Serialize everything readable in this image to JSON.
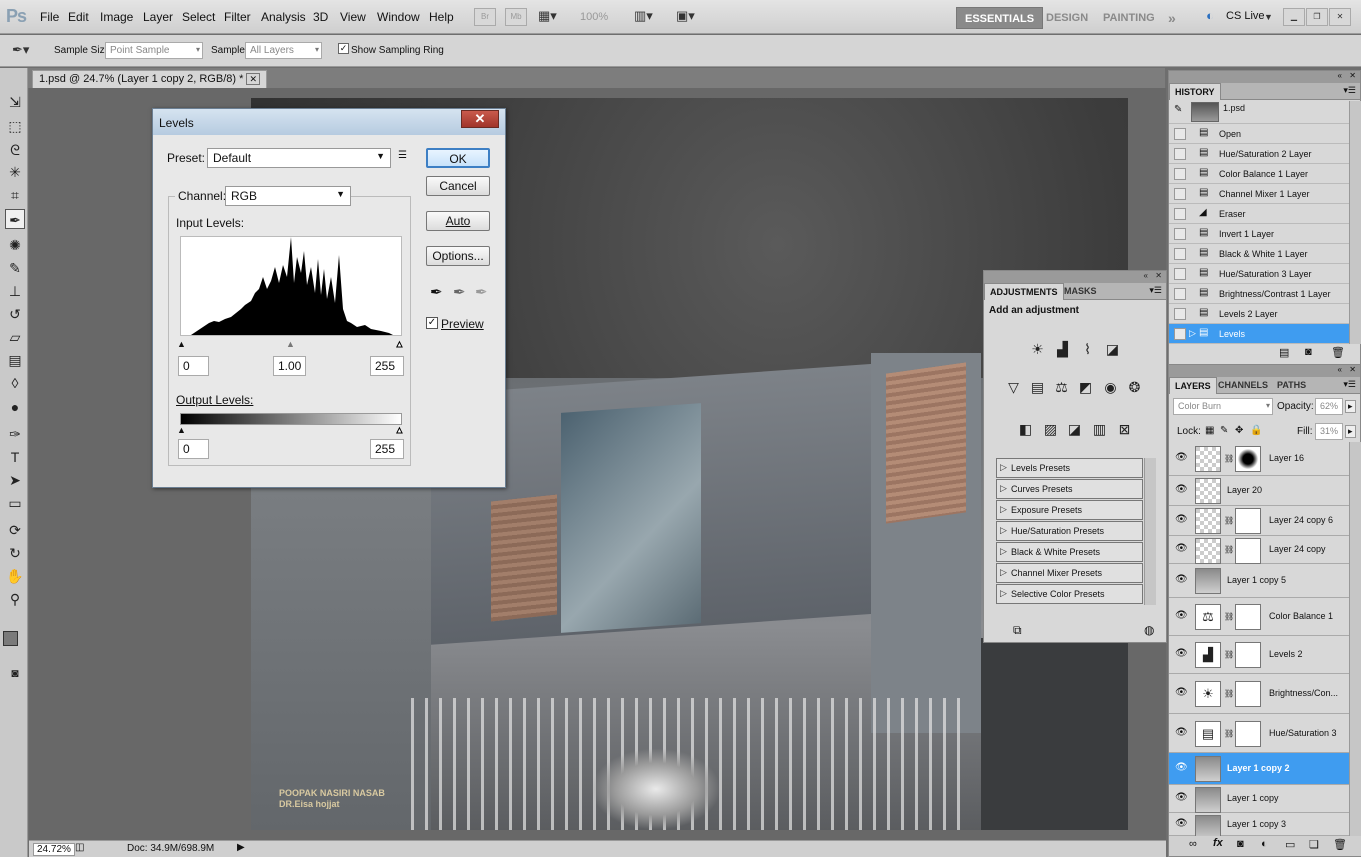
{
  "app": {
    "logo": "Ps"
  },
  "menu": [
    "File",
    "Edit",
    "Image",
    "Layer",
    "Select",
    "Filter",
    "Analysis",
    "3D",
    "View",
    "Window",
    "Help"
  ],
  "toolbar_top": {
    "zoom": "100%",
    "br": "Br",
    "mb": "Mb"
  },
  "workspaces": {
    "essentials": "ESSENTIALS",
    "design": "DESIGN",
    "painting": "PAINTING",
    "more": "»",
    "cslive": "CS Live"
  },
  "options": {
    "sample_size_label": "Sample Size:",
    "sample_size_value": "Point Sample",
    "sample_label": "Sample:",
    "sample_value": "All Layers",
    "sampling_ring": "Show Sampling Ring"
  },
  "document": {
    "tab": "1.psd @ 24.7% (Layer 1 copy 2, RGB/8) *",
    "zoom": "24.72%",
    "doc_size": "Doc: 34.9M/698.9M"
  },
  "image_credit": {
    "line1": "POOPAK NASIRI NASAB",
    "line2": "DR.Eisa hojjat"
  },
  "levels": {
    "title": "Levels",
    "preset_label": "Preset:",
    "preset_value": "Default",
    "channel_label": "Channel:",
    "channel_value": "RGB",
    "input_label": "Input Levels:",
    "input_values": [
      "0",
      "1.00",
      "255"
    ],
    "output_label": "Output Levels:",
    "output_values": [
      "0",
      "255"
    ],
    "buttons": {
      "ok": "OK",
      "cancel": "Cancel",
      "auto": "Auto",
      "options": "Options..."
    },
    "preview": "Preview"
  },
  "adjustments": {
    "tabs": [
      "ADJUSTMENTS",
      "MASKS"
    ],
    "heading": "Add an adjustment",
    "presets": [
      "Levels Presets",
      "Curves Presets",
      "Exposure Presets",
      "Hue/Saturation Presets",
      "Black & White Presets",
      "Channel Mixer Presets",
      "Selective Color Presets"
    ]
  },
  "history": {
    "title": "HISTORY",
    "snapshot": "1.psd",
    "items": [
      "Open",
      "Hue/Saturation 2 Layer",
      "Color Balance 1 Layer",
      "Channel Mixer 1 Layer",
      "Eraser",
      "Invert 1 Layer",
      "Black & White 1 Layer",
      "Hue/Saturation 3 Layer",
      "Brightness/Contrast 1 Layer",
      "Levels 2 Layer",
      "Levels"
    ],
    "active_index": 10
  },
  "layers": {
    "tabs": [
      "LAYERS",
      "CHANNELS",
      "PATHS"
    ],
    "blend_mode": "Color Burn",
    "opacity_label": "Opacity:",
    "opacity": "62%",
    "lock_label": "Lock:",
    "fill_label": "Fill:",
    "fill": "31%",
    "items": [
      "Layer 16",
      "Layer 20",
      "Layer 24 copy 6",
      "Layer 24 copy",
      "Layer 1 copy 5",
      "Color Balance 1",
      "Levels 2",
      "Brightness/Con...",
      "Hue/Saturation 3",
      "Layer 1 copy 2",
      "Layer 1 copy",
      "Layer 1 copy 3"
    ],
    "active_index": 9
  },
  "colors": {
    "accent": "#3f9cf0",
    "chrome": "#d5d5d5",
    "canvas_bg": "#686868"
  }
}
